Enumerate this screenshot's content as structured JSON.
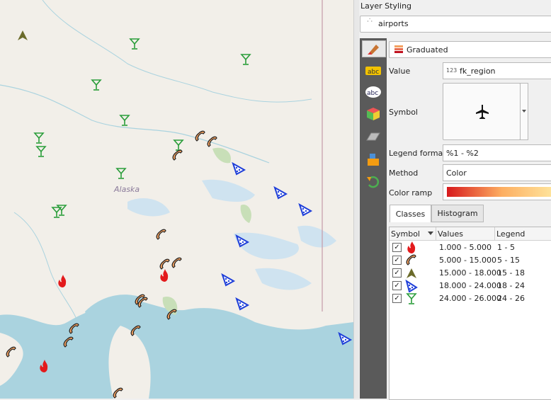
{
  "map": {
    "region_label": "Alaska"
  },
  "panel": {
    "title": "Layer Styling",
    "layer": "airports",
    "renderer": "Graduated",
    "labels": {
      "value": "Value",
      "symbol": "Symbol",
      "legend_format": "Legend format",
      "method": "Method",
      "color_ramp": "Color ramp"
    },
    "value_type": "123",
    "value_field": "fk_region",
    "legend_format": "%1 - %2",
    "method": "Color",
    "tabs": [
      "Classes",
      "Histogram"
    ],
    "columns": [
      "Symbol",
      "Values",
      "Legend"
    ],
    "classes": [
      {
        "values": "1.000 - 5.000",
        "legend": "1 - 5",
        "icon": "fire-icon",
        "color": "#e31a1c"
      },
      {
        "values": "5.000 - 15.000",
        "legend": "5 - 15",
        "icon": "phone-icon",
        "color": "#f4a261"
      },
      {
        "values": "15.000 - 18.000",
        "legend": "15 - 18",
        "icon": "mountain-icon",
        "color": "#6b6b2a"
      },
      {
        "values": "18.000 - 24.000",
        "legend": "18 - 24",
        "icon": "pizza-icon",
        "color": "#1f3fd9"
      },
      {
        "values": "24.000 - 26.000",
        "legend": "24 - 26",
        "icon": "cocktail-icon",
        "color": "#2a9d3a"
      }
    ],
    "ramp_colors": [
      "#d7191c",
      "#fdae61",
      "#fee8a0"
    ]
  }
}
